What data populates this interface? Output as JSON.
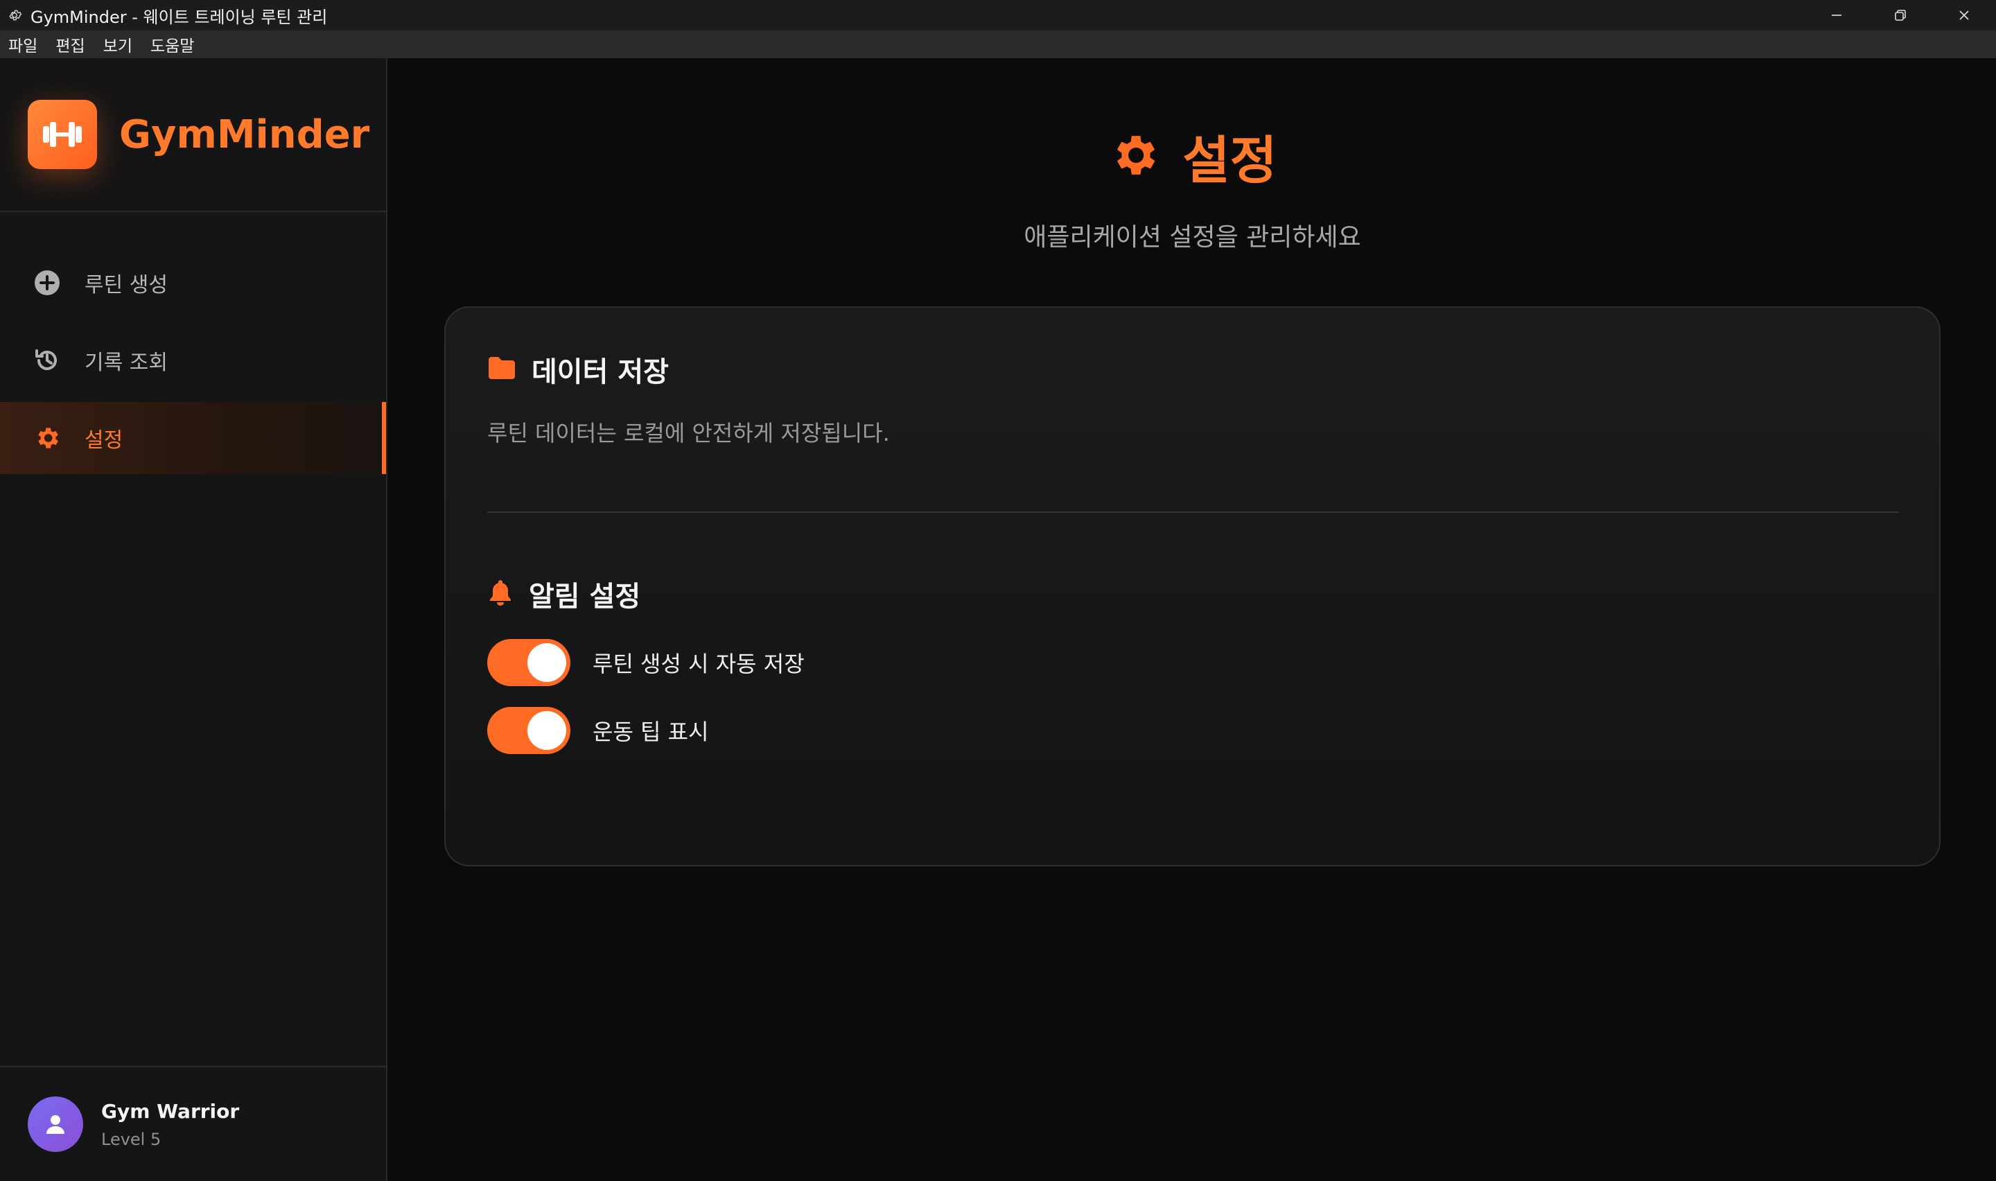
{
  "window": {
    "title": "GymMinder - 웨이트 트레이닝 루틴 관리"
  },
  "menu": [
    "파일",
    "편집",
    "보기",
    "도움말"
  ],
  "sidebar": {
    "brand": "GymMinder",
    "items": [
      {
        "label": "루틴 생성",
        "icon": "plus-circle-icon",
        "active": false
      },
      {
        "label": "기록 조회",
        "icon": "history-icon",
        "active": false
      },
      {
        "label": "설정",
        "icon": "gear-icon",
        "active": true
      }
    ],
    "user": {
      "name": "Gym Warrior",
      "level": "Level 5"
    }
  },
  "page": {
    "title": "설정",
    "subtitle": "애플리케이션 설정을 관리하세요"
  },
  "card": {
    "data_section": {
      "title": "데이터 저장",
      "description": "루틴 데이터는 로컬에 안전하게 저장됩니다."
    },
    "notification_section": {
      "title": "알림 설정",
      "toggles": [
        {
          "label": "루틴 생성 시 자동 저장",
          "on": true
        },
        {
          "label": "운동 팁 표시",
          "on": true
        }
      ]
    }
  },
  "colors": {
    "accent": "#ff6a24",
    "brand_text": "#ff7a2a",
    "background": "#0b0b0b",
    "sidebar": "#151515",
    "card": "#181818"
  }
}
